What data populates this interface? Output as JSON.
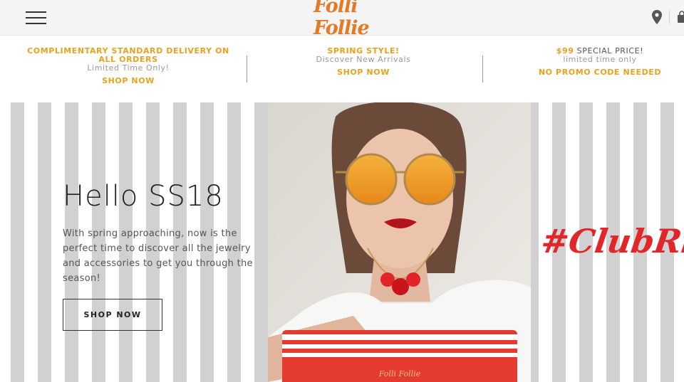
{
  "header": {
    "brand": "Folli Follie",
    "menu_icon": "hamburger-menu-icon",
    "store_icon": "location-pin-icon",
    "bag_icon": "shopping-bag-icon"
  },
  "promos": [
    {
      "headline": "COMPLIMENTARY STANDARD DELIVERY ON ALL ORDERS",
      "subtext": "Limited Time Only!",
      "link": "SHOP NOW"
    },
    {
      "headline": "SPRING STYLE!",
      "subtext": "Discover New Arrivals",
      "link": "SHOP NOW"
    },
    {
      "headline_accent": "$99",
      "headline_rest": " SPECIAL PRICE!",
      "subtext": "limited time only",
      "link": "NO PROMO CODE NEEDED"
    }
  ],
  "hero": {
    "title": "Hello SS18",
    "body": "With spring approaching, now is the perfect time to discover all the jewelry and accessories to get you through the season!",
    "cta": "SHOP NOW",
    "hashtag": "#ClubRivie",
    "clutch_logo": "Folli Follie"
  },
  "colors": {
    "accent_orange": "#e8a21e",
    "brand_orange": "#e47a28",
    "stripe_grey": "#d1d1d1",
    "hashtag_red": "#e0262b"
  }
}
